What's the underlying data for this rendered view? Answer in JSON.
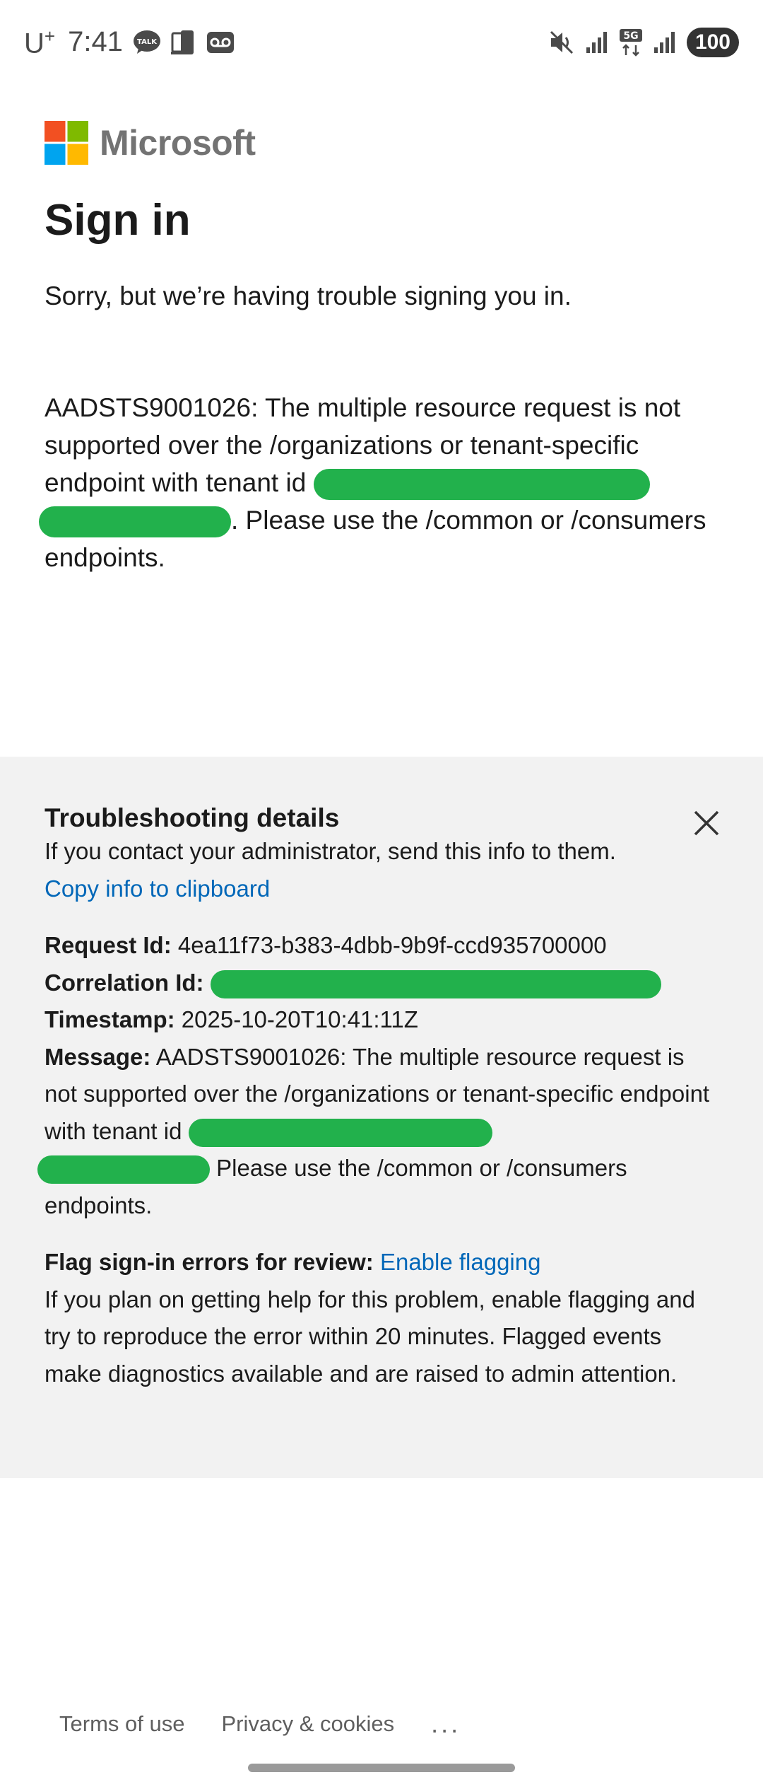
{
  "status_bar": {
    "carrier": "U",
    "carrier_sup": "+",
    "time": "7:41",
    "notif_talk": "TALK",
    "network": "5G",
    "battery": "100"
  },
  "brand": {
    "name": "Microsoft",
    "logo_colors": [
      "#f25022",
      "#7fba00",
      "#00a4ef",
      "#ffb900"
    ]
  },
  "page": {
    "title": "Sign in",
    "subtitle": "Sorry, but we’re having trouble signing you in.",
    "error_prefix": "AADSTS9001026: The multiple resource request is not supported over the /organizations or tenant-specific endpoint with tenant id ",
    "error_suffix": ". Please use the /common or /consumers endpoints."
  },
  "troubleshooting": {
    "title": "Troubleshooting details",
    "intro": "If you contact your administrator, send this info to them.",
    "copy_link": "Copy info to clipboard",
    "request_label": "Request Id:",
    "request_value": "4ea11f73-b383-4dbb-9b9f-ccd935700000",
    "correlation_label": "Correlation Id:",
    "timestamp_label": "Timestamp:",
    "timestamp_value": "2025-10-20T10:41:11Z",
    "message_label": "Message:",
    "message_prefix": "AADSTS9001026: The multiple resource request is not supported over the /organizations or tenant-specific endpoint with tenant id ",
    "message_suffix": " Please use the /common or /consumers endpoints.",
    "flag_label": "Flag sign-in errors for review:",
    "flag_link": "Enable flagging",
    "flag_text": "If you plan on getting help for this problem, enable flagging and try to reproduce the error within 20 minutes. Flagged events make diagnostics available and are raised to admin attention."
  },
  "footer": {
    "terms": "Terms of use",
    "privacy": "Privacy & cookies",
    "more": "..."
  },
  "colors": {
    "link": "#0067b8",
    "redaction": "#22b14c",
    "panel_bg": "#f2f2f2"
  }
}
